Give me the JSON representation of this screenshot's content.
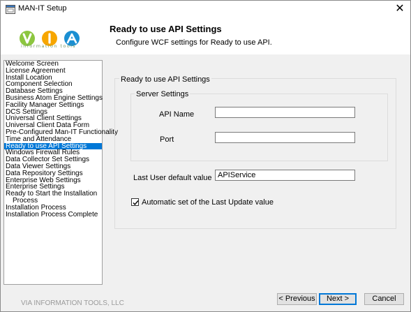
{
  "window": {
    "title": "MAN-IT Setup",
    "close_glyph": "✕"
  },
  "header": {
    "logo_tagline": "information tools",
    "title": "Ready to use API Settings",
    "subtitle": "Configure WCF settings for Ready to use API."
  },
  "sidebar": {
    "selected_index": 13,
    "items": [
      {
        "label": "Welcome Screen"
      },
      {
        "label": "License Agreement"
      },
      {
        "label": "Install Location"
      },
      {
        "label": "Component Selection"
      },
      {
        "label": "Database Settings"
      },
      {
        "label": "Business Atom Engine Settings"
      },
      {
        "label": "Facility Manager Settings"
      },
      {
        "label": "DCS Settings"
      },
      {
        "label": "Universal Client Settings"
      },
      {
        "label": "Universal Client Data Form"
      },
      {
        "label": "Pre-Configured Man-IT Functionality"
      },
      {
        "label": "Time and Attendance"
      },
      {
        "label": "Ready to use API Settings"
      },
      {
        "label": "Windows Firewall Rules"
      },
      {
        "label": "Data Collector Set Settings"
      },
      {
        "label": "Data Viewer Settings"
      },
      {
        "label": "Data Repository Settings"
      },
      {
        "label": "Enterprise Web Settings"
      },
      {
        "label": "Enterprise Settings"
      },
      {
        "label": "Ready to Start the Installation"
      },
      {
        "label": "Process"
      },
      {
        "label": "Installation Process"
      },
      {
        "label": "Installation Process Complete"
      }
    ]
  },
  "form": {
    "group_label": "Ready to use API Settings",
    "server_group_label": "Server Settings",
    "api_name_label": "API Name",
    "api_name_value": "",
    "port_label": "Port",
    "port_value": "",
    "last_user_label": "Last User default value",
    "last_user_value": "APIService",
    "auto_set_label": "Automatic set of the Last Update value",
    "auto_set_checked": true
  },
  "footer": {
    "company": "VIA INFORMATION TOOLS, LLC",
    "previous_label": "< Previous",
    "next_label": "Next >",
    "cancel_label": "Cancel"
  },
  "colors": {
    "selection": "#0078d7",
    "logo_v": "#8cc63f",
    "logo_i": "#f7a600",
    "logo_a": "#1b8fd2"
  }
}
